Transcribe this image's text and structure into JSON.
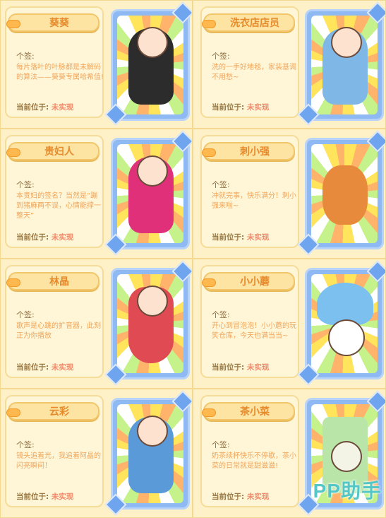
{
  "common": {
    "sig_label": "个签:",
    "location_label": "当前位于:"
  },
  "cards": [
    {
      "name": "葵葵",
      "signature": "每片落叶的叶脉都是未解码的算法——葵葵专属哈希值!",
      "location": "未实现",
      "char_color": "#2c2c2c",
      "accent": "#39e35a"
    },
    {
      "name": "洗衣店店员",
      "signature": "洗的一手好地毯，家装基调不用愁~",
      "location": "未实现",
      "char_color": "#7fb8e6",
      "accent": "#d9835a"
    },
    {
      "name": "贵妇人",
      "signature": "本贵妇的签名？当然是“蹦到猪麻两不误，心情能撑一整天”",
      "location": "未实现",
      "char_color": "#e0307a",
      "accent": "#a06a3a"
    },
    {
      "name": "刺小强",
      "signature": "冲就完事，快乐满分！刺小强来啦~",
      "location": "未实现",
      "char_color": "#e88a3c",
      "accent": "#ff5a2a"
    },
    {
      "name": "林晶",
      "signature": "歌声是心跳的扩音器，此刻正为你播放",
      "location": "未实现",
      "char_color": "#e04a52",
      "accent": "#3a2a2a"
    },
    {
      "name": "小小蘑",
      "signature": "开心到冒泡泡！小小蘑的玩笑仓库，今天也满当当~",
      "location": "未实现",
      "char_color": "#7cc0f0",
      "accent": "#ffffff"
    },
    {
      "name": "云彩",
      "signature": "镜头追着光，我追着阿晶的闪亮瞬间！",
      "location": "未实现",
      "char_color": "#5b9ad8",
      "accent": "#7a4a2a"
    },
    {
      "name": "茶小菜",
      "signature": "奶茶续杯快乐不停歇，茶小菜的日常就是甜滋滋!",
      "location": "未实现",
      "char_color": "#b9e6a8",
      "accent": "#f3f3e6"
    }
  ],
  "watermark": "PP助手"
}
